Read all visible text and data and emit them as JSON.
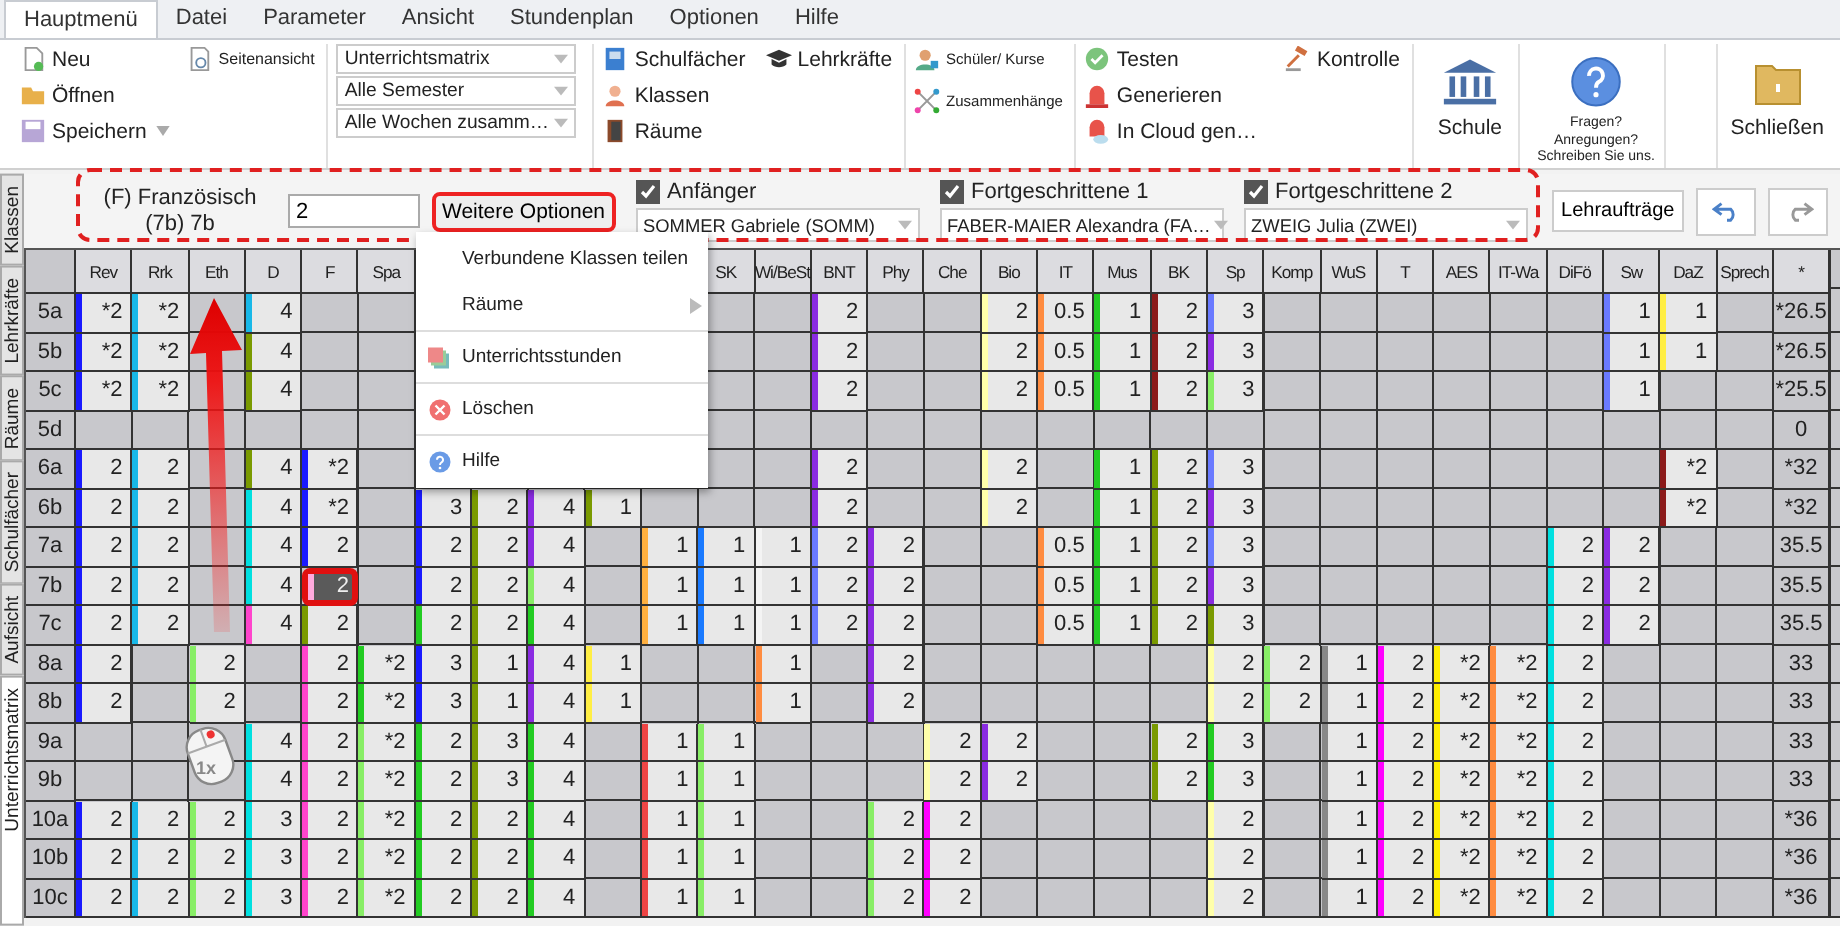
{
  "menu_tabs": [
    {
      "label": "Hauptmenü",
      "selected": true
    },
    {
      "label": "Datei",
      "selected": false
    },
    {
      "label": "Parameter",
      "selected": false
    },
    {
      "label": "Ansicht",
      "selected": false
    },
    {
      "label": "Stundenplan",
      "selected": false
    },
    {
      "label": "Optionen",
      "selected": false
    },
    {
      "label": "Hilfe",
      "selected": false
    }
  ],
  "ribbon": {
    "new": "Neu",
    "open": "Öffnen",
    "save": "Speichern",
    "page_view": "Seitenansicht",
    "dropdowns": [
      "Unterrichtsmatrix",
      "Alle Semester",
      "Alle Wochen zusamm…"
    ],
    "subjects": "Schulfächer",
    "teachers": "Lehrkräfte",
    "classes": "Klassen",
    "rooms": "Räume",
    "students": "Schüler/ Kurse",
    "relations": "Zusammenhänge",
    "test": "Testen",
    "check": "Kontrolle",
    "generate": "Generieren",
    "cloud": "In Cloud gen…",
    "school": "Schule",
    "feedback_lines": [
      "Fragen?",
      "Anregungen?",
      "Schreiben Sie uns."
    ],
    "close": "Schließen"
  },
  "side_tabs": [
    {
      "label": "Klassen",
      "selected": false
    },
    {
      "label": "Lehrkräfte",
      "selected": false
    },
    {
      "label": "Räume",
      "selected": false
    },
    {
      "label": "Schulfächer",
      "selected": false
    },
    {
      "label": "Aufsicht",
      "selected": false
    },
    {
      "label": "Unterrichtsmatrix",
      "selected": true
    }
  ],
  "lesson": {
    "subject": "(F) Französisch",
    "class": "(7b) 7b",
    "hours": "2",
    "more_button": "Weitere Optionen",
    "groups": [
      {
        "label": "Anfänger",
        "checked": true,
        "teacher": "SOMMER Gabriele (SOMM)"
      },
      {
        "label": "Fortgeschrittene 1",
        "checked": true,
        "teacher": "FABER-MAIER Alexandra (FA…"
      },
      {
        "label": "Fortgeschrittene 2",
        "checked": true,
        "teacher": "ZWEIG Julia (ZWEI)"
      }
    ]
  },
  "assignments_button": "Lehraufträge",
  "table": {
    "columns": [
      {
        "label": "Rev"
      },
      {
        "label": "Rrk"
      },
      {
        "label": "Eth"
      },
      {
        "label": "D"
      },
      {
        "label": "F"
      },
      {
        "label": "Spa"
      },
      {},
      {},
      {},
      {},
      {},
      {
        "label": "SK"
      },
      {
        "label": "Wi/BeSt"
      },
      {
        "label": "BNT"
      },
      {
        "label": "Phy"
      },
      {
        "label": "Che"
      },
      {
        "label": "Bio"
      },
      {
        "label": "IT"
      },
      {
        "label": "Mus"
      },
      {
        "label": "BK"
      },
      {
        "label": "Sp"
      },
      {
        "label": "Komp"
      },
      {
        "label": "WuS"
      },
      {
        "label": "T"
      },
      {
        "label": "AES"
      },
      {
        "label": "IT-Wa"
      },
      {
        "label": "DiFö"
      },
      {
        "label": "Sw"
      },
      {
        "label": "DaZ"
      },
      {
        "label": "Sprech"
      },
      {
        "label": "*"
      }
    ],
    "rows": [
      {
        "label": "5a",
        "cells": [
          {
            "value": "*2",
            "color": "#1a1aff"
          },
          {
            "value": "*2",
            "color": "#18b8e8"
          },
          {},
          {
            "value": "4",
            "color": "#18b8e8"
          },
          {},
          {},
          {},
          {},
          {},
          {},
          {},
          {},
          {},
          {
            "value": "2",
            "color": "#8a2be2"
          },
          {},
          {},
          {
            "value": "2",
            "color": "#ffffaa"
          },
          {
            "value": "0.5",
            "color": "#ff8c40"
          },
          {
            "value": "1",
            "color": "#22cc22"
          },
          {
            "value": "2",
            "color": "#8b1a1a"
          },
          {
            "value": "3",
            "color": "#6a7aff"
          },
          {},
          {},
          {},
          {},
          {},
          {},
          {
            "value": "1",
            "color": "#6a7aff"
          },
          {
            "value": "1",
            "color": "#ffee44"
          },
          {},
          {
            "value": "*26.5"
          }
        ]
      },
      {
        "label": "5b",
        "cells": [
          {
            "value": "*2",
            "color": "#1a1aff"
          },
          {
            "value": "*2",
            "color": "#18b8e8"
          },
          {},
          {
            "value": "4",
            "color": "#7a9a00"
          },
          {},
          {},
          {},
          {},
          {},
          {},
          {},
          {},
          {},
          {
            "value": "2",
            "color": "#8a2be2"
          },
          {},
          {},
          {
            "value": "2",
            "color": "#ffffaa"
          },
          {
            "value": "0.5",
            "color": "#ff8c40"
          },
          {
            "value": "1",
            "color": "#22cc22"
          },
          {
            "value": "2",
            "color": "#8b1a1a"
          },
          {
            "value": "3",
            "color": "#8a2be2"
          },
          {},
          {},
          {},
          {},
          {},
          {},
          {
            "value": "1",
            "color": "#6a7aff"
          },
          {
            "value": "1",
            "color": "#ffee44"
          },
          {},
          {
            "value": "*26.5"
          }
        ]
      },
      {
        "label": "5c",
        "cells": [
          {
            "value": "*2",
            "color": "#1a1aff"
          },
          {
            "value": "*2",
            "color": "#18b8e8"
          },
          {},
          {
            "value": "4",
            "color": "#7a9a00"
          },
          {},
          {},
          {},
          {},
          {},
          {},
          {},
          {},
          {},
          {
            "value": "2",
            "color": "#8a2be2"
          },
          {},
          {},
          {
            "value": "2",
            "color": "#ffffaa"
          },
          {
            "value": "0.5",
            "color": "#ff8c40"
          },
          {
            "value": "1",
            "color": "#22cc22"
          },
          {
            "value": "2",
            "color": "#8b1a1a"
          },
          {
            "value": "3",
            "color": "#88ee66"
          },
          {},
          {},
          {},
          {},
          {},
          {},
          {
            "value": "1",
            "color": "#6a7aff"
          },
          {},
          {},
          {
            "value": "*25.5"
          }
        ]
      },
      {
        "label": "5d",
        "cells": [
          {},
          {},
          {},
          {},
          {},
          {},
          {},
          {},
          {},
          {},
          {},
          {},
          {},
          {},
          {},
          {},
          {},
          {},
          {},
          {},
          {},
          {},
          {},
          {},
          {},
          {},
          {},
          {},
          {},
          {},
          {
            "value": "0"
          }
        ]
      },
      {
        "label": "6a",
        "cells": [
          {
            "value": "2",
            "color": "#1a1aff"
          },
          {
            "value": "2",
            "color": "#18b8e8"
          },
          {},
          {
            "value": "4",
            "color": "#7a9a00"
          },
          {
            "value": "*2",
            "color": "#1a1aff"
          },
          {},
          {},
          {},
          {},
          {},
          {},
          {},
          {},
          {
            "value": "2",
            "color": "#8a2be2"
          },
          {},
          {},
          {
            "value": "2",
            "color": "#ffffaa"
          },
          {},
          {
            "value": "1",
            "color": "#22cc22"
          },
          {
            "value": "2",
            "color": "#7a9a00"
          },
          {
            "value": "3",
            "color": "#6a7aff"
          },
          {},
          {},
          {},
          {},
          {},
          {},
          {},
          {
            "value": "*2",
            "color": "#8b1a1a"
          },
          {},
          {
            "value": "*32"
          }
        ]
      },
      {
        "label": "6b",
        "cells": [
          {
            "value": "2",
            "color": "#1a1aff"
          },
          {
            "value": "2",
            "color": "#18b8e8"
          },
          {},
          {
            "value": "4",
            "color": "#00e0e0"
          },
          {
            "value": "*2",
            "color": "#1a1aff"
          },
          {},
          {
            "value": "3",
            "color": "#1a1aff"
          },
          {
            "value": "2",
            "color": "#7a9a00"
          },
          {
            "value": "4",
            "color": "#8a2be2"
          },
          {
            "value": "1",
            "color": "#7a9a00"
          },
          {},
          {},
          {},
          {
            "value": "2",
            "color": "#8a2be2"
          },
          {},
          {},
          {
            "value": "2",
            "color": "#ffffaa"
          },
          {},
          {
            "value": "1",
            "color": "#22cc22"
          },
          {
            "value": "2",
            "color": "#7a9a00"
          },
          {
            "value": "3",
            "color": "#8a2be2"
          },
          {},
          {},
          {},
          {},
          {},
          {},
          {},
          {
            "value": "*2",
            "color": "#8b1a1a"
          },
          {},
          {
            "value": "*32"
          }
        ]
      },
      {
        "label": "7a",
        "cells": [
          {
            "value": "2",
            "color": "#1a1aff"
          },
          {
            "value": "2",
            "color": "#18b8e8"
          },
          {},
          {
            "value": "4",
            "color": "#00e0e0"
          },
          {
            "value": "2",
            "color": "#1a1aff"
          },
          {},
          {
            "value": "2",
            "color": "#1a1aff"
          },
          {
            "value": "2",
            "color": "#7a9a00"
          },
          {
            "value": "4",
            "color": "#8a2be2"
          },
          {},
          {
            "value": "1",
            "color": "#ffb040"
          },
          {
            "value": "1",
            "color": "#1a7aff"
          },
          {
            "value": "1",
            "color": "#f4f4f4"
          },
          {
            "value": "2",
            "color": "#6a7aff"
          },
          {
            "value": "2",
            "color": "#8a2be2"
          },
          {},
          {},
          {
            "value": "0.5",
            "color": "#ff8c40"
          },
          {
            "value": "1",
            "color": "#22cc22"
          },
          {
            "value": "2",
            "color": "#7a9a00"
          },
          {
            "value": "3",
            "color": "#6a7aff"
          },
          {},
          {},
          {},
          {},
          {},
          {
            "value": "2",
            "color": "#00e0e0"
          },
          {
            "value": "2",
            "color": "#8a2be2"
          },
          {},
          {},
          {
            "value": "35.5"
          }
        ]
      },
      {
        "label": "7b",
        "cells": [
          {
            "value": "2",
            "color": "#1a1aff"
          },
          {
            "value": "2",
            "color": "#18b8e8"
          },
          {},
          {
            "value": "4",
            "color": "#00e0e0"
          },
          {
            "value": "2",
            "color": "#ffaadd",
            "selected": true
          },
          {},
          {
            "value": "2",
            "color": "#1a1aff"
          },
          {
            "value": "2",
            "color": "#7a9a00"
          },
          {
            "value": "4",
            "color": "#88ee66"
          },
          {},
          {
            "value": "1",
            "color": "#ffb040"
          },
          {
            "value": "1",
            "color": "#1a7aff"
          },
          {
            "value": "1",
            "color": "#f4f4f4"
          },
          {
            "value": "2",
            "color": "#6a7aff"
          },
          {
            "value": "2",
            "color": "#8a2be2"
          },
          {},
          {},
          {
            "value": "0.5",
            "color": "#ff8c40"
          },
          {
            "value": "1",
            "color": "#22cc22"
          },
          {
            "value": "2",
            "color": "#7a9a00"
          },
          {
            "value": "3",
            "color": "#8a2be2"
          },
          {},
          {},
          {},
          {},
          {},
          {
            "value": "2",
            "color": "#00e0e0"
          },
          {
            "value": "2",
            "color": "#8a2be2"
          },
          {},
          {},
          {
            "value": "35.5"
          }
        ]
      },
      {
        "label": "7c",
        "cells": [
          {
            "value": "2",
            "color": "#1a1aff"
          },
          {
            "value": "2",
            "color": "#18b8e8"
          },
          {},
          {
            "value": "4",
            "color": "#ff44cc"
          },
          {
            "value": "2",
            "color": "#7a9a00"
          },
          {},
          {
            "value": "2",
            "color": "#22cc22"
          },
          {
            "value": "2",
            "color": "#7a9a00"
          },
          {
            "value": "4",
            "color": "#22cc22"
          },
          {},
          {
            "value": "1",
            "color": "#ffb040"
          },
          {
            "value": "1",
            "color": "#1a7aff"
          },
          {
            "value": "1",
            "color": "#f4f4f4"
          },
          {
            "value": "2",
            "color": "#6a7aff"
          },
          {
            "value": "2",
            "color": "#8a2be2"
          },
          {},
          {},
          {
            "value": "0.5",
            "color": "#ff8c40"
          },
          {
            "value": "1",
            "color": "#22cc22"
          },
          {
            "value": "2",
            "color": "#7a9a00"
          },
          {
            "value": "3",
            "color": "#7a9a00"
          },
          {},
          {},
          {},
          {},
          {},
          {
            "value": "2",
            "color": "#00e0e0"
          },
          {
            "value": "2",
            "color": "#8a2be2"
          },
          {},
          {},
          {
            "value": "35.5"
          }
        ]
      },
      {
        "label": "8a",
        "cells": [
          {
            "value": "2",
            "color": "#1a1aff"
          },
          {},
          {
            "value": "2",
            "color": "#88ee66"
          },
          {},
          {
            "value": "2",
            "color": "#ff44cc"
          },
          {
            "value": "*2",
            "color": "#22cc22"
          },
          {
            "value": "3",
            "color": "#1a1aff"
          },
          {
            "value": "1",
            "color": "#7a9a00"
          },
          {
            "value": "4",
            "color": "#8a2be2"
          },
          {
            "value": "1",
            "color": "#ffee44"
          },
          {},
          {},
          {
            "value": "1",
            "color": "#ff8c40"
          },
          {},
          {
            "value": "2",
            "color": "#8a2be2"
          },
          {},
          {},
          {},
          {},
          {},
          {
            "value": "2",
            "color": "#ffffaa"
          },
          {
            "value": "2",
            "color": "#88ee66"
          },
          {
            "value": "1",
            "color": "#888888"
          },
          {
            "value": "2",
            "color": "#ff00ff"
          },
          {
            "value": "*2",
            "color": "#ffee00"
          },
          {
            "value": "*2",
            "color": "#ff8c40"
          },
          {
            "value": "2",
            "color": "#00e0e0"
          },
          {},
          {},
          {},
          {
            "value": "33"
          }
        ]
      },
      {
        "label": "8b",
        "cells": [
          {
            "value": "2",
            "color": "#1a1aff"
          },
          {},
          {
            "value": "2",
            "color": "#88ee66"
          },
          {},
          {
            "value": "2",
            "color": "#ff44cc"
          },
          {
            "value": "*2",
            "color": "#22cc22"
          },
          {
            "value": "3",
            "color": "#1a1aff"
          },
          {
            "value": "1",
            "color": "#7a9a00"
          },
          {
            "value": "4",
            "color": "#8a2be2"
          },
          {
            "value": "1",
            "color": "#ffee44"
          },
          {},
          {},
          {
            "value": "1",
            "color": "#ff8c40"
          },
          {},
          {
            "value": "2",
            "color": "#8a2be2"
          },
          {},
          {},
          {},
          {},
          {},
          {
            "value": "2",
            "color": "#ffffaa"
          },
          {
            "value": "2",
            "color": "#88ee66"
          },
          {
            "value": "1",
            "color": "#888888"
          },
          {
            "value": "2",
            "color": "#ff00ff"
          },
          {
            "value": "*2",
            "color": "#ffee00"
          },
          {
            "value": "*2",
            "color": "#ff8c40"
          },
          {
            "value": "2",
            "color": "#00e0e0"
          },
          {},
          {},
          {},
          {
            "value": "33"
          }
        ]
      },
      {
        "label": "9a",
        "cells": [
          {},
          {},
          {},
          {
            "value": "4",
            "color": "#00e0e0"
          },
          {
            "value": "2",
            "color": "#ff44cc"
          },
          {
            "value": "*2",
            "color": "#88ee66"
          },
          {
            "value": "2",
            "color": "#22cc22"
          },
          {
            "value": "3",
            "color": "#7a9a00"
          },
          {
            "value": "4",
            "color": "#22cc22"
          },
          {},
          {
            "value": "1",
            "color": "#ee4444"
          },
          {
            "value": "1",
            "color": "#88ee66"
          },
          {},
          {},
          {},
          {
            "value": "2",
            "color": "#ffffaa"
          },
          {
            "value": "2",
            "color": "#8a2be2"
          },
          {},
          {},
          {
            "value": "2",
            "color": "#7a9a00"
          },
          {
            "value": "3",
            "color": "#22cc22"
          },
          {},
          {
            "value": "1",
            "color": "#888888"
          },
          {
            "value": "2",
            "color": "#ff00ff"
          },
          {
            "value": "*2",
            "color": "#ffee00"
          },
          {
            "value": "*2",
            "color": "#ff8c40"
          },
          {
            "value": "2",
            "color": "#00e0e0"
          },
          {},
          {},
          {},
          {
            "value": "33"
          }
        ]
      },
      {
        "label": "9b",
        "cells": [
          {},
          {},
          {},
          {
            "value": "4",
            "color": "#00e0e0"
          },
          {
            "value": "2",
            "color": "#ff44cc"
          },
          {
            "value": "*2",
            "color": "#88ee66"
          },
          {
            "value": "2",
            "color": "#22cc22"
          },
          {
            "value": "3",
            "color": "#7a9a00"
          },
          {
            "value": "4",
            "color": "#22cc22"
          },
          {},
          {
            "value": "1",
            "color": "#ee4444"
          },
          {
            "value": "1",
            "color": "#88ee66"
          },
          {},
          {},
          {},
          {
            "value": "2",
            "color": "#ffffaa"
          },
          {
            "value": "2",
            "color": "#8a2be2"
          },
          {},
          {},
          {
            "value": "2",
            "color": "#7a9a00"
          },
          {
            "value": "3",
            "color": "#22cc22"
          },
          {},
          {
            "value": "1",
            "color": "#888888"
          },
          {
            "value": "2",
            "color": "#ff00ff"
          },
          {
            "value": "*2",
            "color": "#ffee00"
          },
          {
            "value": "*2",
            "color": "#ff8c40"
          },
          {
            "value": "2",
            "color": "#00e0e0"
          },
          {},
          {},
          {},
          {
            "value": "33"
          }
        ]
      },
      {
        "label": "10a",
        "cells": [
          {
            "value": "2",
            "color": "#1a1aff"
          },
          {
            "value": "2",
            "color": "#18b8e8"
          },
          {
            "value": "2",
            "color": "#88ee66"
          },
          {
            "value": "3",
            "color": "#00e0e0"
          },
          {
            "value": "2",
            "color": "#ff44cc"
          },
          {
            "value": "*2",
            "color": "#88ee66"
          },
          {
            "value": "2",
            "color": "#22cc22"
          },
          {
            "value": "2",
            "color": "#7a9a00"
          },
          {
            "value": "4",
            "color": "#22cc22"
          },
          {},
          {
            "value": "1",
            "color": "#ee4444"
          },
          {
            "value": "1",
            "color": "#88ee66"
          },
          {},
          {},
          {
            "value": "2",
            "color": "#88ee66"
          },
          {
            "value": "2",
            "color": "#ff00ff"
          },
          {},
          {},
          {},
          {},
          {
            "value": "2",
            "color": "#ffffaa"
          },
          {},
          {
            "value": "1",
            "color": "#888888"
          },
          {
            "value": "2",
            "color": "#ff00ff"
          },
          {
            "value": "*2",
            "color": "#ffee00"
          },
          {
            "value": "*2",
            "color": "#ff8c40"
          },
          {
            "value": "2",
            "color": "#00e0e0"
          },
          {},
          {},
          {},
          {
            "value": "*36"
          }
        ]
      },
      {
        "label": "10b",
        "cells": [
          {
            "value": "2",
            "color": "#1a1aff"
          },
          {
            "value": "2",
            "color": "#18b8e8"
          },
          {
            "value": "2",
            "color": "#88ee66"
          },
          {
            "value": "3",
            "color": "#00e0e0"
          },
          {
            "value": "2",
            "color": "#ff44cc"
          },
          {
            "value": "*2",
            "color": "#88ee66"
          },
          {
            "value": "2",
            "color": "#22cc22"
          },
          {
            "value": "2",
            "color": "#7a9a00"
          },
          {
            "value": "4",
            "color": "#22cc22"
          },
          {},
          {
            "value": "1",
            "color": "#ee4444"
          },
          {
            "value": "1",
            "color": "#88ee66"
          },
          {},
          {},
          {
            "value": "2",
            "color": "#88ee66"
          },
          {
            "value": "2",
            "color": "#ff00ff"
          },
          {},
          {},
          {},
          {},
          {
            "value": "2",
            "color": "#ffffaa"
          },
          {},
          {
            "value": "1",
            "color": "#888888"
          },
          {
            "value": "2",
            "color": "#ff00ff"
          },
          {
            "value": "*2",
            "color": "#ffee00"
          },
          {
            "value": "*2",
            "color": "#ff8c40"
          },
          {
            "value": "2",
            "color": "#00e0e0"
          },
          {},
          {},
          {},
          {
            "value": "*36"
          }
        ]
      },
      {
        "label": "10c",
        "cells": [
          {
            "value": "2",
            "color": "#1a1aff"
          },
          {
            "value": "2",
            "color": "#18b8e8"
          },
          {
            "value": "2",
            "color": "#88ee66"
          },
          {
            "value": "3",
            "color": "#00e0e0"
          },
          {
            "value": "2",
            "color": "#ff44cc"
          },
          {
            "value": "*2",
            "color": "#88ee66"
          },
          {
            "value": "2",
            "color": "#22cc22"
          },
          {
            "value": "2",
            "color": "#7a9a00"
          },
          {
            "value": "4",
            "color": "#22cc22"
          },
          {},
          {
            "value": "1",
            "color": "#ee4444"
          },
          {
            "value": "1",
            "color": "#88ee66"
          },
          {},
          {},
          {
            "value": "2",
            "color": "#88ee66"
          },
          {
            "value": "2",
            "color": "#ff00ff"
          },
          {},
          {},
          {},
          {},
          {
            "value": "2",
            "color": "#ffffaa"
          },
          {},
          {
            "value": "1",
            "color": "#888888"
          },
          {
            "value": "2",
            "color": "#ff00ff"
          },
          {
            "value": "*2",
            "color": "#ffee00"
          },
          {
            "value": "*2",
            "color": "#ff8c40"
          },
          {
            "value": "2",
            "color": "#00e0e0"
          },
          {},
          {},
          {},
          {
            "value": "*36"
          }
        ]
      }
    ]
  },
  "context_menu": [
    {
      "label": "Verbundene Klassen teilen",
      "kind": "plain"
    },
    {
      "label": "Räume",
      "kind": "submenu"
    },
    {
      "label": "Unterrichtsstunden",
      "kind": "lessons"
    },
    {
      "label": "Löschen",
      "kind": "delete"
    },
    {
      "label": "Hilfe",
      "kind": "help"
    }
  ],
  "annotation": {
    "mouse_label": "1x"
  }
}
